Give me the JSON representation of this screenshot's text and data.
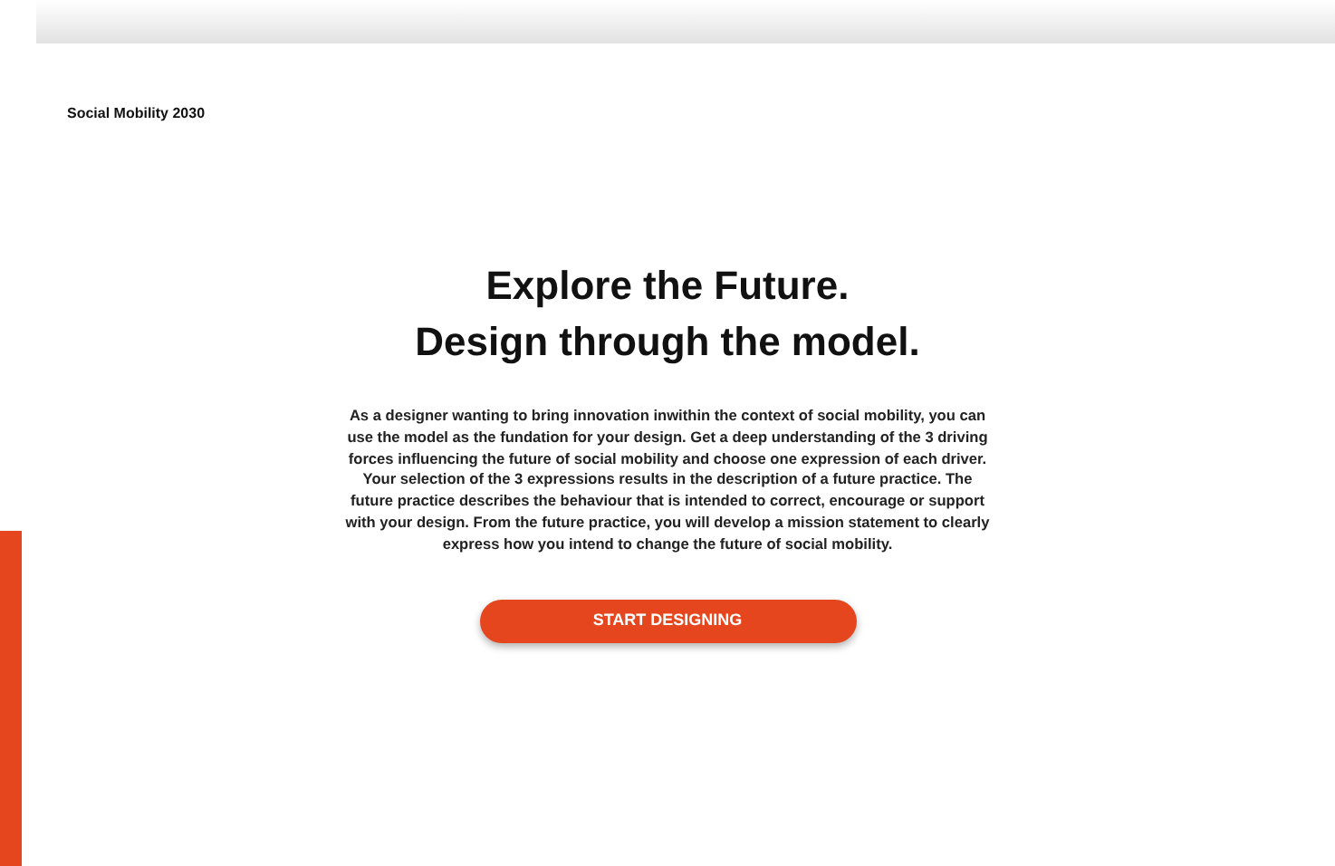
{
  "brand": "Social Mobility 2030",
  "headline": [
    "Explore the Future.",
    "Design through the model."
  ],
  "intro": "As a designer wanting to bring innovation inwithin the context of social mobility, you can use the model as the fundation for your design. Get a deep understanding of the 3 driving forces influencing the future of social mobility and choose one expression of each driver.  Your selection of the 3 expressions results in the description of a future practice. The future practice describes the behaviour that is intended to correct, encourage or support with your design. From the future practice, you will develop a mission statement to clearly express how you intend to change the future of social mobility.",
  "cta": "START DESIGNING"
}
